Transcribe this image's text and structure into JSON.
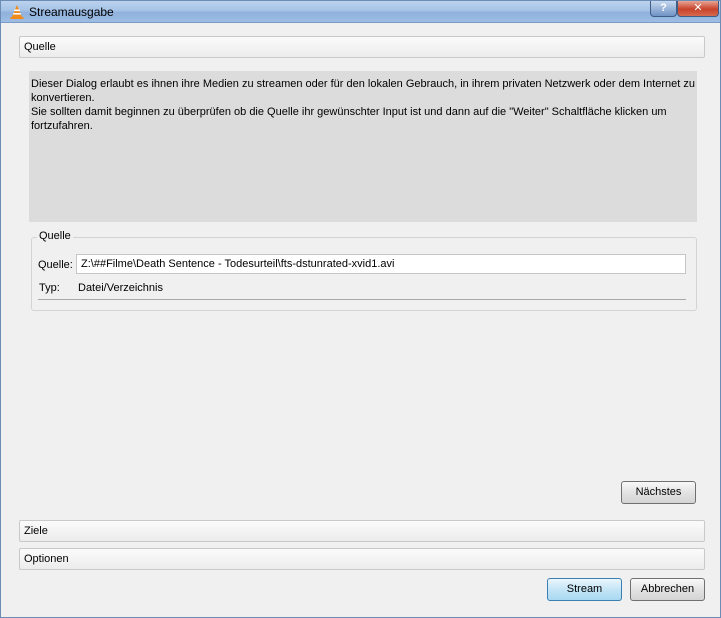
{
  "window": {
    "title": "Streamausgabe",
    "help_glyph": "?",
    "close_glyph": "✕"
  },
  "sections": {
    "source_header": "Quelle",
    "targets_header": "Ziele",
    "options_header": "Optionen"
  },
  "info": {
    "line1": "Dieser Dialog erlaubt es ihnen ihre Medien zu streamen oder für den lokalen Gebrauch, in ihrem privaten Netzwerk oder dem Internet zu konvertieren.",
    "line2": "Sie sollten damit beginnen zu überprüfen ob die Quelle ihr gewünschter Input ist und dann auf die \"Weiter\" Schaltfläche klicken um fortzufahren."
  },
  "source_group": {
    "title": "Quelle",
    "source_label": "Quelle:",
    "source_value": "Z:\\##Filme\\Death Sentence - Todesurteil\\fts-dstunrated-xvid1.avi",
    "type_label": "Typ:",
    "type_value": "Datei/Verzeichnis"
  },
  "buttons": {
    "next": "Nächstes",
    "stream": "Stream",
    "cancel": "Abbrechen"
  },
  "icons": {
    "app": "vlc-cone-icon"
  },
  "colors": {
    "titlebar": "#a5c2e6",
    "info_panel": "#dcdcdc",
    "close_button": "#c8422b",
    "default_button": "#a9d9f2"
  }
}
